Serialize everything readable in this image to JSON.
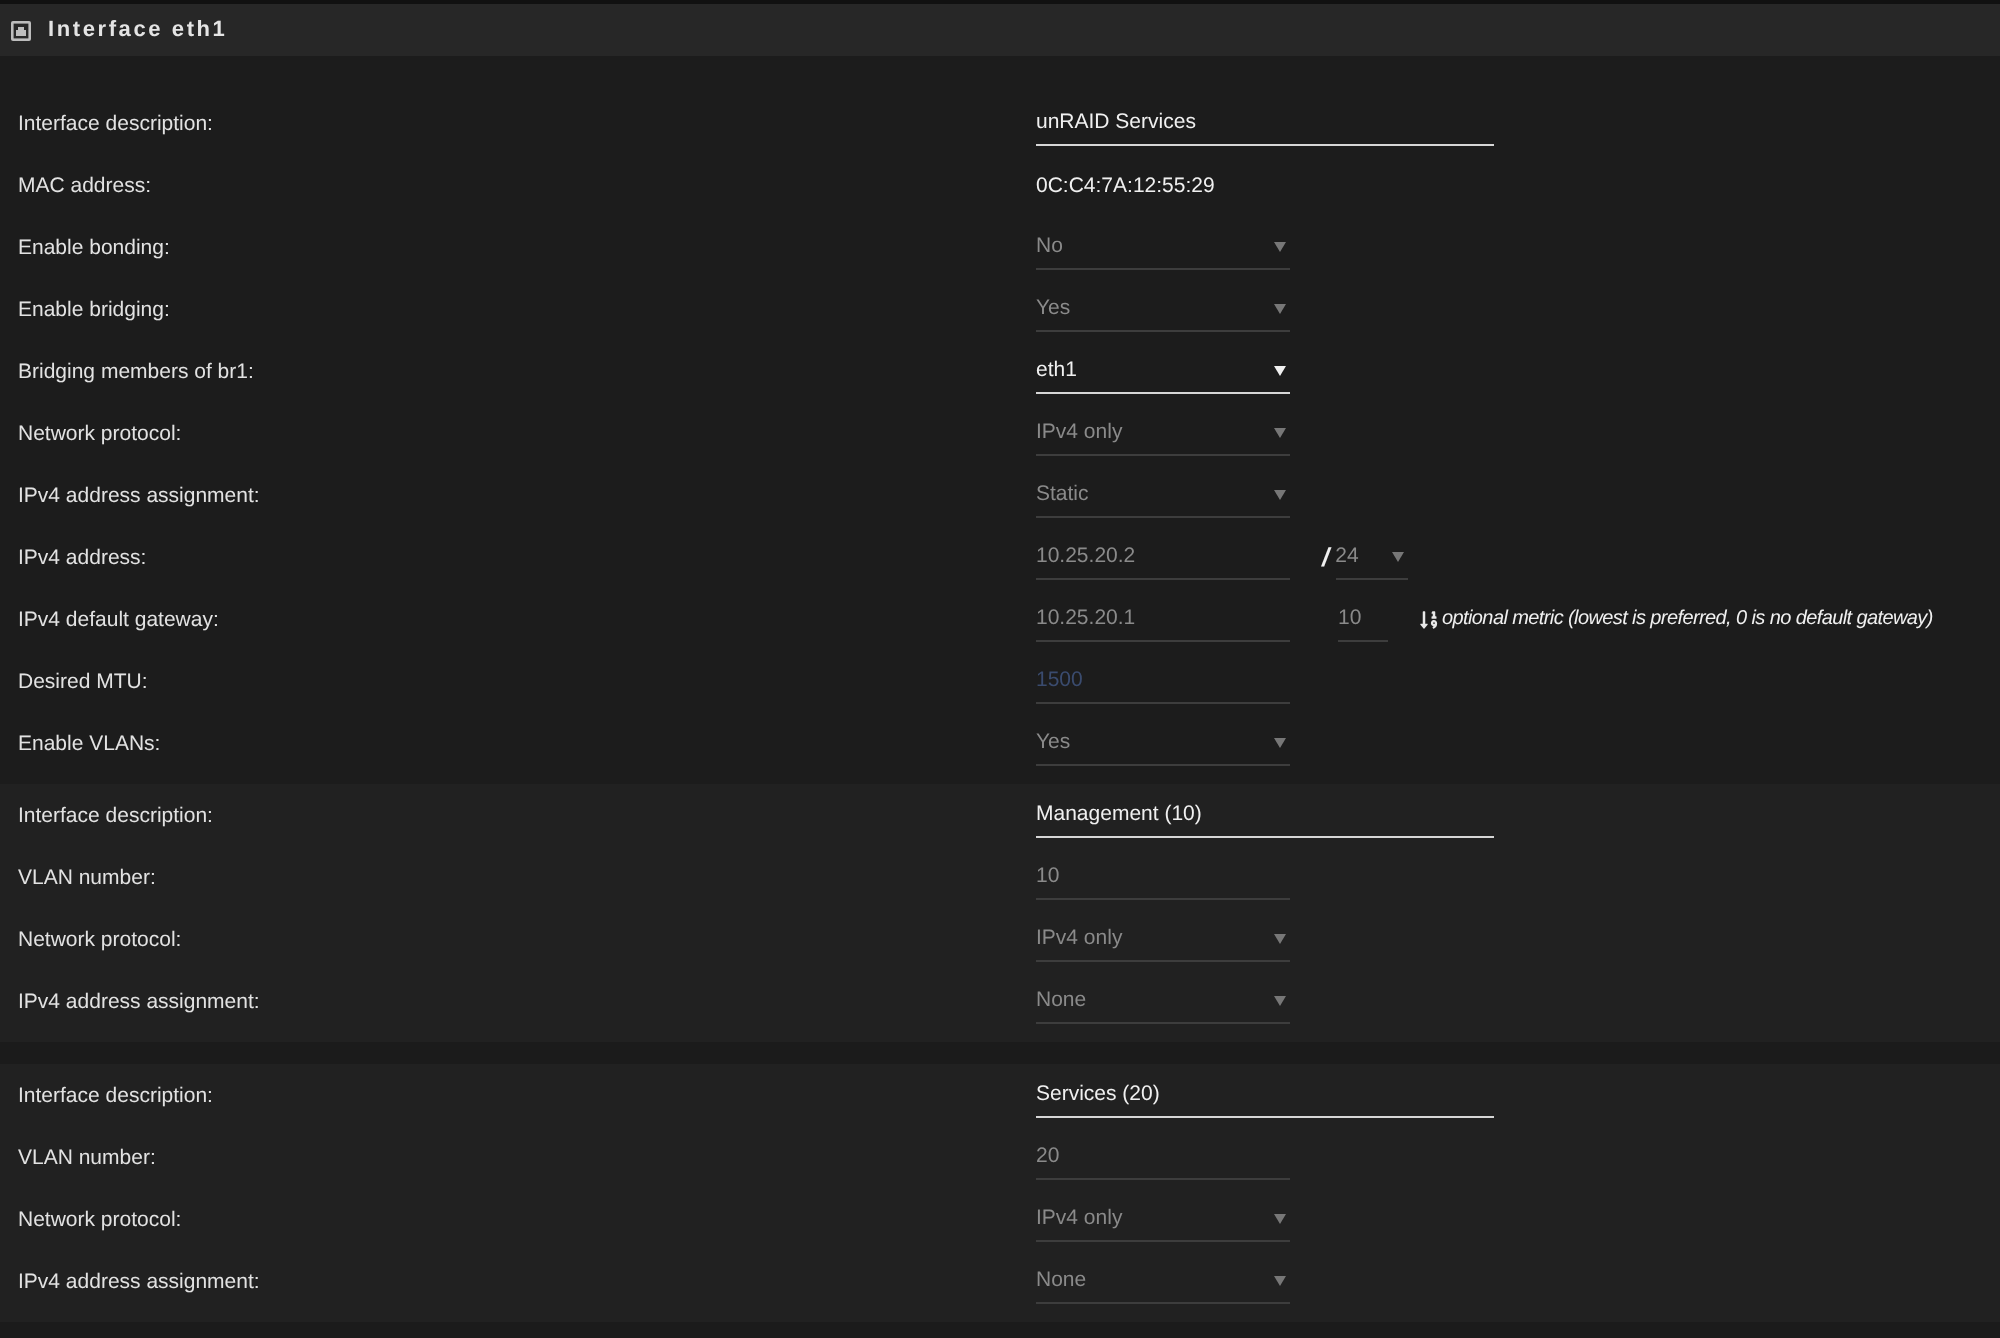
{
  "panel": {
    "title": "Interface eth1"
  },
  "sections": [
    {
      "kind": "interface",
      "rows": [
        {
          "label": "Interface description:",
          "kind": "text",
          "value": "unRAID Services",
          "disabled": false
        },
        {
          "label": "MAC address:",
          "kind": "static",
          "value": "0C:C4:7A:12:55:29",
          "disabled": false
        },
        {
          "label": "Enable bonding:",
          "kind": "select",
          "value": "No",
          "disabled": true
        },
        {
          "label": "Enable bridging:",
          "kind": "select",
          "value": "Yes",
          "disabled": true
        },
        {
          "label": "Bridging members of br1:",
          "kind": "select",
          "value": "eth1",
          "disabled": false
        },
        {
          "label": "Network protocol:",
          "kind": "select",
          "value": "IPv4 only",
          "disabled": true
        },
        {
          "label": "IPv4 address assignment:",
          "kind": "select",
          "value": "Static",
          "disabled": true
        },
        {
          "label": "IPv4 address:",
          "kind": "number",
          "value": "10.25.20.2",
          "disabled": true,
          "separator": "/",
          "netmask": {
            "value": "24",
            "disabled": true
          }
        },
        {
          "label": "IPv4 default gateway:",
          "kind": "number",
          "value": "10.25.20.1",
          "disabled": true,
          "metric": {
            "value": "10",
            "disabled": true
          },
          "note": "optional metric (lowest is preferred, 0 is no default gateway)"
        },
        {
          "label": "Desired MTU:",
          "kind": "number",
          "placeholder": "1500",
          "disabled": true
        },
        {
          "label": "Enable VLANs:",
          "kind": "select",
          "value": "Yes",
          "disabled": true
        }
      ]
    },
    {
      "kind": "vlan",
      "rows": [
        {
          "label": "Interface description:",
          "kind": "text",
          "value": "Management (10)",
          "disabled": false
        },
        {
          "label": "VLAN number:",
          "kind": "number",
          "value": "10",
          "disabled": true
        },
        {
          "label": "Network protocol:",
          "kind": "select",
          "value": "IPv4 only",
          "disabled": true
        },
        {
          "label": "IPv4 address assignment:",
          "kind": "select",
          "value": "None",
          "disabled": true
        }
      ]
    },
    {
      "kind": "vlan",
      "rows": [
        {
          "label": "Interface description:",
          "kind": "text",
          "value": "Services (20)",
          "disabled": false
        },
        {
          "label": "VLAN number:",
          "kind": "number",
          "value": "20",
          "disabled": true
        },
        {
          "label": "Network protocol:",
          "kind": "select",
          "value": "IPv4 only",
          "disabled": true
        },
        {
          "label": "IPv4 address assignment:",
          "kind": "select",
          "value": "None",
          "disabled": true
        }
      ]
    }
  ]
}
